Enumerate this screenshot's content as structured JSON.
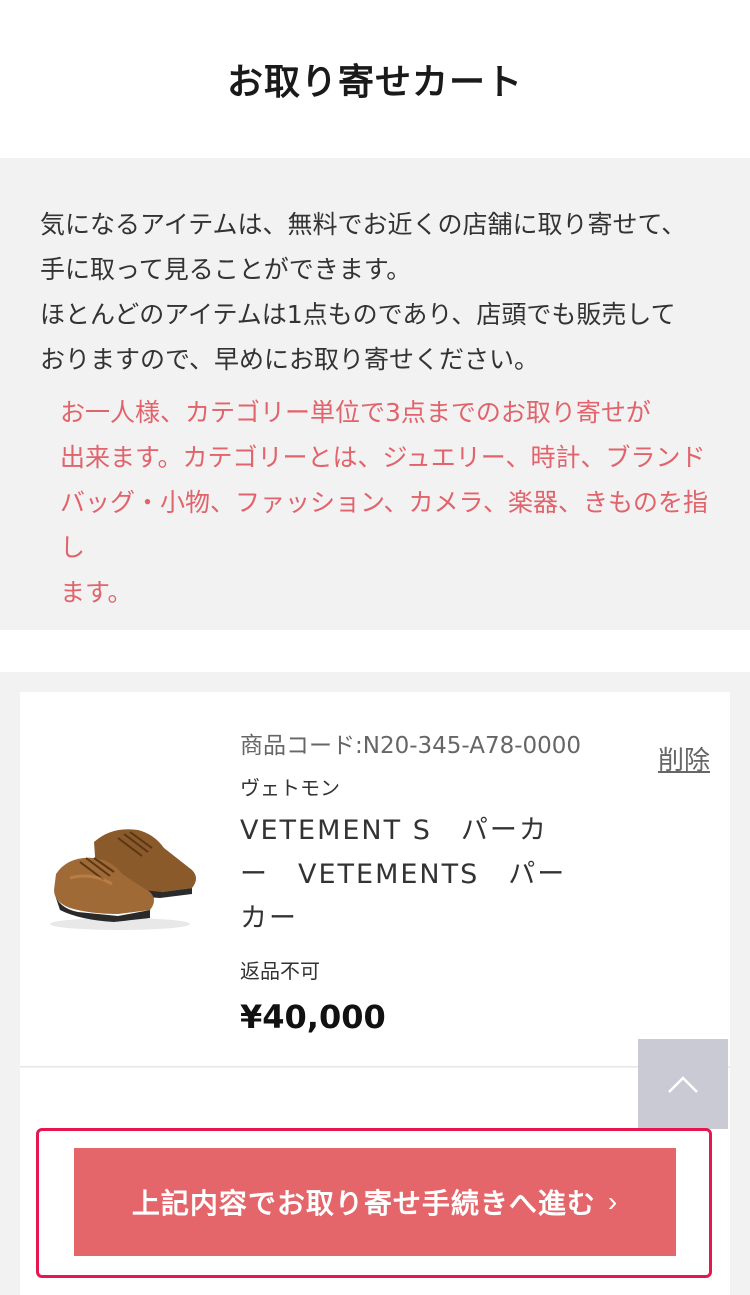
{
  "header": {
    "title": "お取り寄せカート"
  },
  "notice": {
    "intro_lines": [
      "気になるアイテムは、無料でお近くの店舗に取り寄せて、",
      "手に取って見ることができます。",
      "ほとんどのアイテムは1点ものであり、店頭でも販売して",
      "おりますので、早めにお取り寄せください。"
    ],
    "limit_lines": [
      "お一人様、カテゴリー単位で3点までのお取り寄せが",
      "出来ます。カテゴリーとは、ジュエリー、時計、ブランド",
      "バッグ・小物、ファッション、カメラ、楽器、きものを指し",
      "ます。"
    ]
  },
  "cart_item": {
    "code": "商品コード:N20-345-A78-0000",
    "brand": "ヴェトモン",
    "name_lines": [
      "VETEMENT S　パーカ",
      "ー　VETEMENTS　パー",
      "カー"
    ],
    "return_policy": "返品不可",
    "price": "¥40,000",
    "delete_label": "削除",
    "image_icon": "shoe-image"
  },
  "actions": {
    "proceed_label": "上記内容でお取り寄せ手続きへ進む",
    "proceed_chevron": "›",
    "scroll_top_icon": "chevron-up-icon"
  },
  "colors": {
    "accent": "#e5666a",
    "limit_text": "#e1636b",
    "focus_frame": "#e5174f",
    "background_gray": "#f2f2f2"
  }
}
